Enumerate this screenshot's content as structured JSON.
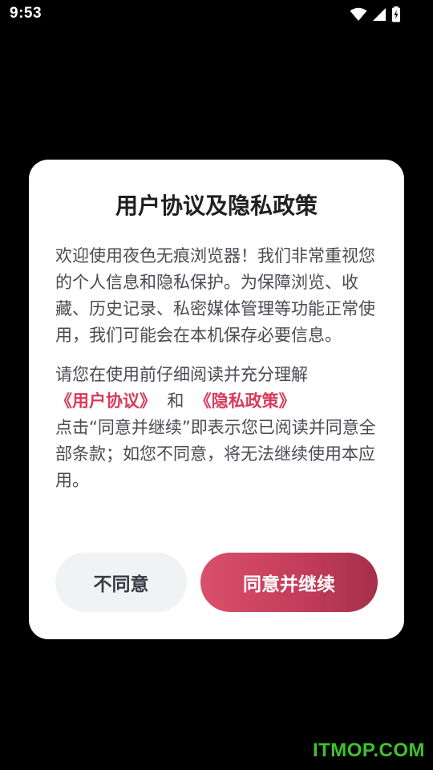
{
  "status_bar": {
    "time": "9:53"
  },
  "dialog": {
    "title": "用户协议及隐私政策",
    "para1": "欢迎使用夜色无痕浏览器！我们非常重视您的个人信息和隐私保护。为保障浏览、收藏、历史记录、私密媒体管理等功能正常使用，我们可能会在本机保存必要信息。",
    "para2_intro": "请您在使用前仔细阅读并充分理解",
    "user_agreement_link": "《用户协议》",
    "and_text": "和",
    "privacy_policy_link": "《隐私政策》",
    "para2_outro": "点击“同意并继续”即表示您已阅读并同意全部条款；如您不同意，将无法继续使用本应用。",
    "decline_label": "不同意",
    "agree_label": "同意并继续"
  },
  "watermark": "ITMOP.COM",
  "colors": {
    "accent": "#d83b59",
    "agree_gradient_start": "#d9506b",
    "agree_gradient_end": "#a52f4a",
    "decline_bg": "#f1f2f4",
    "watermark": "#3fc22b"
  }
}
